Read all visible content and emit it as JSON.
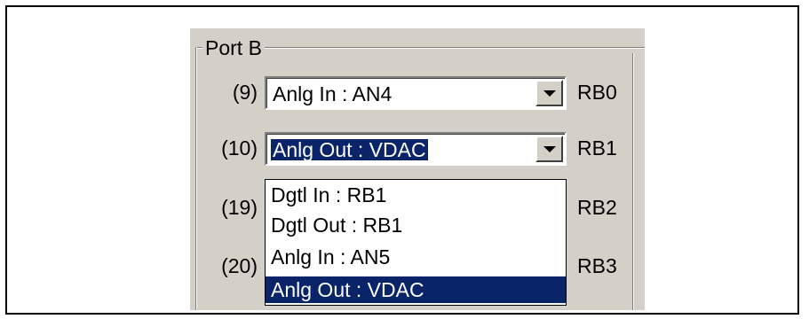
{
  "group": {
    "label": "Port B"
  },
  "rows": [
    {
      "pin": "(9)",
      "value": "Anlg In : AN4",
      "port": "RB0"
    },
    {
      "pin": "(10)",
      "value": "Anlg Out : VDAC",
      "port": "RB1"
    },
    {
      "pin": "(19)",
      "port": "RB2"
    },
    {
      "pin": "(20)",
      "port": "RB3"
    }
  ],
  "dropdown": {
    "items": [
      "Dgtl In : RB1",
      "Dgtl Out : RB1",
      "Anlg In : AN5",
      "Anlg Out : VDAC"
    ],
    "highlighted_index": 3
  }
}
